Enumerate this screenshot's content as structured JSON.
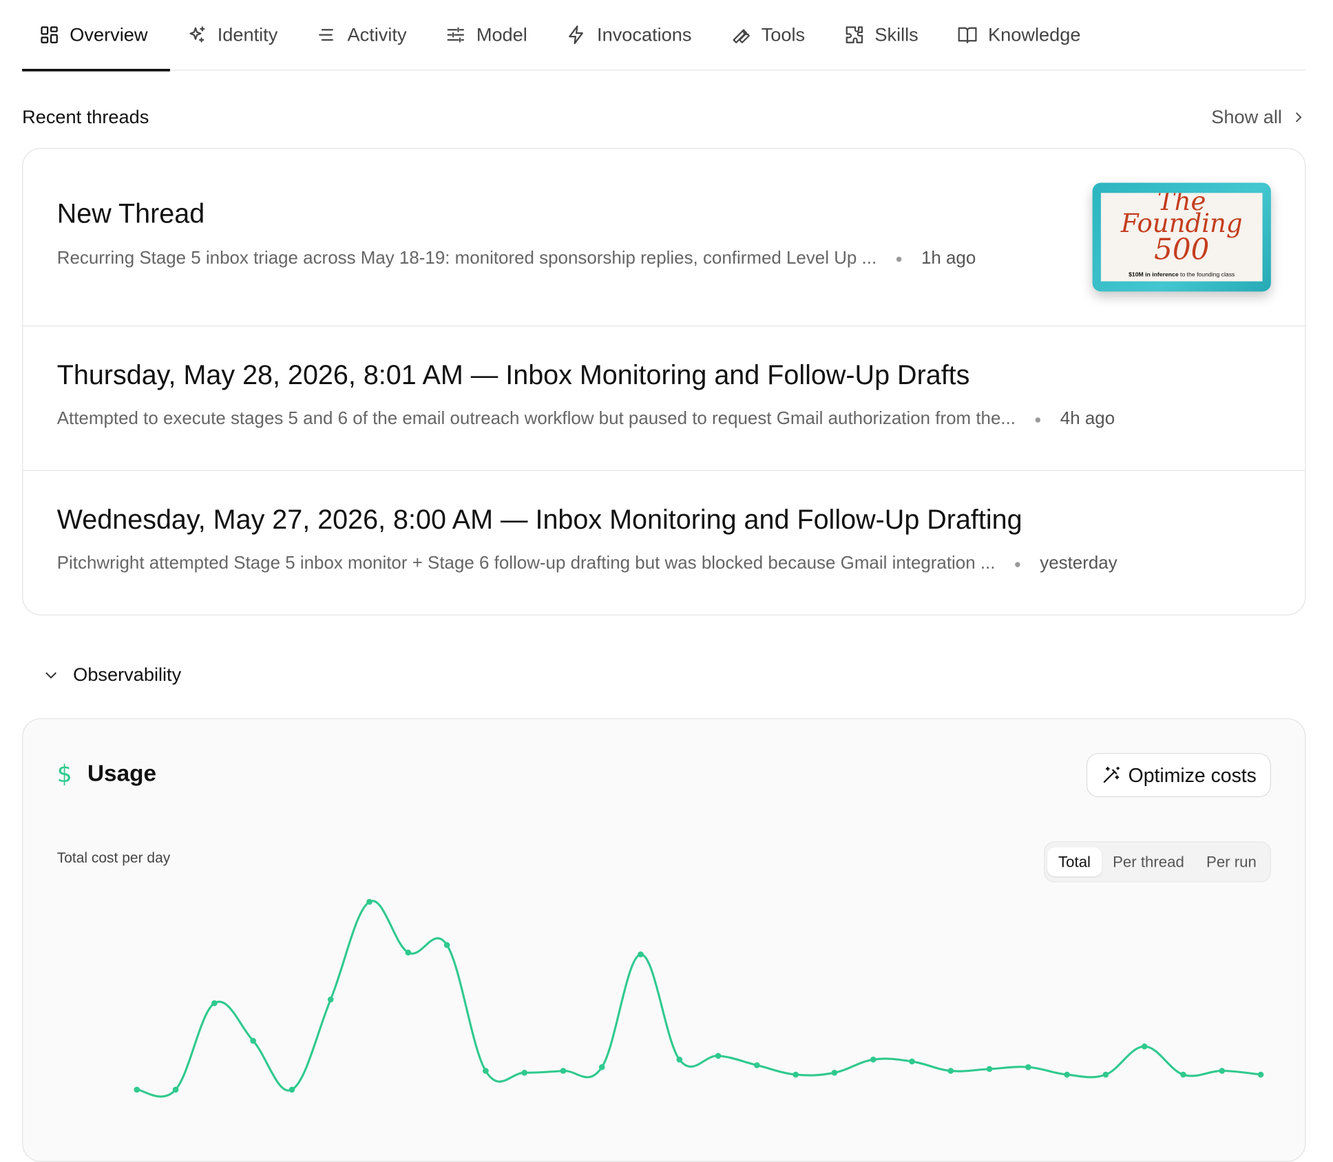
{
  "tabs": [
    {
      "label": "Overview",
      "icon": "grid-icon",
      "active": true
    },
    {
      "label": "Identity",
      "icon": "sparkles-icon"
    },
    {
      "label": "Activity",
      "icon": "lines-icon"
    },
    {
      "label": "Model",
      "icon": "sliders-icon"
    },
    {
      "label": "Invocations",
      "icon": "bolt-icon"
    },
    {
      "label": "Tools",
      "icon": "wrench-icon"
    },
    {
      "label": "Skills",
      "icon": "puzzle-icon"
    },
    {
      "label": "Knowledge",
      "icon": "book-icon"
    }
  ],
  "recent": {
    "title": "Recent threads",
    "show_all": "Show all"
  },
  "threads": [
    {
      "title": "New Thread",
      "summary": "Recurring Stage 5 inbox triage across May 18-19: monitored sponsorship replies, confirmed Level Up ...",
      "time": "1h ago",
      "thumbnail": {
        "line1": "The",
        "line2": "Founding",
        "line3": "500",
        "caption_bold": "$10M in inference",
        "caption_rest": " to the founding class"
      }
    },
    {
      "title": "Thursday, May 28, 2026, 8:01 AM — Inbox Monitoring and Follow-Up Drafts",
      "summary": "Attempted to execute stages 5 and 6 of the email outreach workflow but paused to request Gmail authorization from the...",
      "time": "4h ago"
    },
    {
      "title": "Wednesday, May 27, 2026, 8:00 AM — Inbox Monitoring and Follow-Up Drafting",
      "summary": "Pitchwright attempted Stage 5 inbox monitor + Stage 6 follow-up drafting but was blocked because Gmail integration ...",
      "time": "yesterday"
    }
  ],
  "observability": {
    "title": "Observability"
  },
  "usage": {
    "currency_symbol": "$",
    "title": "Usage",
    "optimize_label": "Optimize costs",
    "chart_label": "Total cost per day",
    "segments": [
      "Total",
      "Per thread",
      "Per run"
    ],
    "active_segment": "Total"
  },
  "colors": {
    "accent_green": "#2fc98e",
    "thumb_teal": "#35bcc6",
    "thumb_red": "#c43d1e"
  },
  "chart_data": {
    "type": "line",
    "title": "Total cost per day",
    "y_unit": "relative (no axis labels shown)",
    "series": [
      {
        "values": [
          0,
          0,
          46,
          26,
          0,
          48,
          100,
          73,
          77,
          10,
          9,
          10,
          12,
          72,
          16,
          18,
          13,
          8,
          9,
          16,
          15,
          10,
          11,
          12,
          8,
          8,
          23,
          8,
          10,
          8
        ]
      }
    ],
    "grid": false,
    "ylim": [
      0,
      100
    ]
  }
}
